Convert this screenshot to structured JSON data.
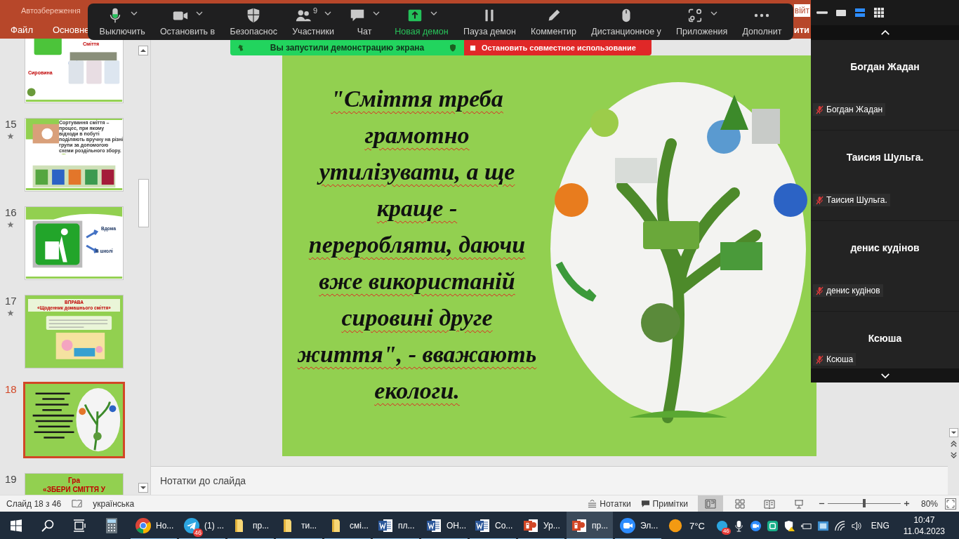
{
  "title_bar": {
    "autosave_label": "Автозбереження",
    "sign_in": "війт"
  },
  "ribbon": {
    "tabs": [
      "Файл",
      "Основне"
    ],
    "right_text": "ити"
  },
  "slides_panel": {
    "thumbnails": [
      {
        "kind": "bins",
        "texts": [
          "Сміття",
          "Сировина"
        ],
        "animated": false,
        "selected": false
      },
      {
        "kind": "sorting",
        "number": "15",
        "texts": [
          "Сортування сміття – процес, при якому відходи в побуті поділяють вручну на різні групи за допомогою схеми роздільного збору."
        ],
        "animated": true,
        "selected": false
      },
      {
        "kind": "sign",
        "number": "16",
        "texts": [
          "Вдома",
          "В школі"
        ],
        "animated": true,
        "selected": false
      },
      {
        "kind": "exercise",
        "number": "17",
        "texts": [
          "ВПРАВА",
          "«Щоденник домашнього сміття»"
        ],
        "animated": true,
        "selected": false
      },
      {
        "kind": "quote",
        "number": "18",
        "animated": false,
        "selected": true
      },
      {
        "kind": "game",
        "number": "19",
        "texts": [
          "Гра",
          "«ЗБЕРИ СМІТТЯ У"
        ],
        "animated": false,
        "selected": false
      }
    ]
  },
  "slide": {
    "quote_lines": [
      "\"Сміття  треба",
      "грамотно",
      "утилізувати, а  ще",
      "краще  -",
      "переробляти,  даючи",
      "вже  використаній",
      "сировині  друге",
      "життя\", - вважають",
      "екологи."
    ]
  },
  "notes": {
    "placeholder": "Нотатки до слайда"
  },
  "meeting_toolbar": {
    "items": [
      {
        "label": "Выключить",
        "caret": true,
        "highlighted": false
      },
      {
        "label": "Остановить в",
        "caret": true,
        "highlighted": false
      },
      {
        "label": "Безопаснос",
        "caret": false,
        "highlighted": false
      },
      {
        "label": "Участники",
        "caret": true,
        "highlighted": false,
        "badge": "9"
      },
      {
        "label": "Чат",
        "caret": true,
        "highlighted": false
      },
      {
        "label": "Новая демон",
        "caret": true,
        "highlighted": true
      },
      {
        "label": "Пауза демон",
        "caret": false,
        "highlighted": false
      },
      {
        "label": "Комментир",
        "caret": false,
        "highlighted": false
      },
      {
        "label": "Дистанционное у",
        "caret": false,
        "highlighted": false
      },
      {
        "label": "Приложения",
        "caret": true,
        "highlighted": false
      },
      {
        "label": "Дополнит",
        "caret": false,
        "highlighted": false
      }
    ]
  },
  "share_banner": {
    "status": "Вы запустили демонстрацию экрана",
    "stop_button": "Остановить совместное использование"
  },
  "video_panel": {
    "layouts": [
      {
        "selected": false
      },
      {
        "selected": false
      },
      {
        "selected": true
      },
      {
        "selected": false
      }
    ],
    "participants": [
      {
        "name": "Богдан Жадан",
        "label": "Богдан Жадан",
        "muted": true
      },
      {
        "name": "Таисия Шульга.",
        "label": "Таисия Шульга.",
        "muted": true
      },
      {
        "name": "денис кудінов",
        "label": "денис кудінов",
        "muted": true
      },
      {
        "name": "Ксюша",
        "label": "Ксюша",
        "muted": true
      }
    ]
  },
  "status_bar": {
    "slide_counter": "Слайд 18 з 46",
    "language": "українська",
    "notes_button": "Нотатки",
    "comments_button": "Примітки",
    "views": [
      {
        "selected": true
      },
      {
        "selected": false
      },
      {
        "selected": false
      },
      {
        "selected": false
      }
    ],
    "zoom": {
      "level": 0.5,
      "reading": "80%"
    }
  },
  "taskbar": {
    "apps": [
      {
        "kind": "calculator",
        "running": false,
        "selected": false
      },
      {
        "kind": "chrome",
        "label": "Но...",
        "running": true,
        "selected": false
      },
      {
        "kind": "telegram",
        "label": "(1) ...",
        "badge": "46",
        "running": true,
        "selected": false
      },
      {
        "kind": "folder",
        "label": "пр...",
        "running": true,
        "selected": false
      },
      {
        "kind": "folder",
        "label": "ти...",
        "running": true,
        "selected": false
      },
      {
        "kind": "folder",
        "label": "смі...",
        "running": true,
        "selected": false
      },
      {
        "kind": "word",
        "label": "пл...",
        "running": true,
        "selected": false
      },
      {
        "kind": "word",
        "label": "ОН...",
        "running": true,
        "selected": false
      },
      {
        "kind": "word",
        "label": "Со...",
        "running": true,
        "selected": false
      },
      {
        "kind": "powerpoint",
        "label": "Ур...",
        "running": true,
        "selected": false
      },
      {
        "kind": "powerpoint",
        "label": "пр...",
        "running": true,
        "selected": true
      },
      {
        "kind": "zoom",
        "label": "Эл...",
        "running": true,
        "selected": false
      }
    ],
    "weather": "7°C",
    "tray_badge": "46",
    "input_language": "ENG",
    "time": "10:47",
    "date": "11.04.2023"
  }
}
